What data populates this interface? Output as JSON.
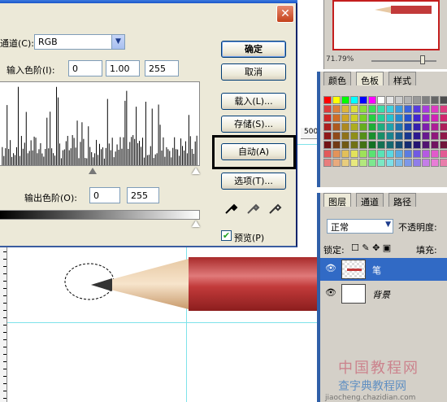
{
  "dialog": {
    "close_glyph": "✕",
    "channel_label": "通道(C):",
    "channel_value": "RGB",
    "input_levels_label": "输入色阶(I):",
    "input_levels": [
      "0",
      "1.00",
      "255"
    ],
    "output_levels_label": "输出色阶(O):",
    "output_levels": [
      "0",
      "255"
    ],
    "buttons": {
      "ok": "确定",
      "cancel": "取消",
      "load": "载入(L)...",
      "save": "存储(S)...",
      "auto": "自动(A)",
      "options": "选项(T)..."
    },
    "preview_label": "预览(P)",
    "preview_checked": true
  },
  "navigator": {
    "zoom": "71.79%"
  },
  "swatches": {
    "tabs": [
      "颜色",
      "色板",
      "样式"
    ],
    "active_tab": "色板"
  },
  "ruler": {
    "h_label": "500"
  },
  "layers": {
    "tabs": [
      "图层",
      "通道",
      "路径"
    ],
    "blend_mode": "正常",
    "opacity_label": "不透明度:",
    "lock_label": "锁定:",
    "fill_label": "填充:",
    "items": [
      {
        "name": "笔",
        "selected": true
      },
      {
        "name": "背景",
        "selected": false
      }
    ]
  },
  "watermark": {
    "line1": "中国教程网",
    "line2": "查字典教程网",
    "line3": "jiaocheng.chazidian.com"
  },
  "colors": {
    "selection_blue": "#316ac5",
    "pencil_red": "#c23a3a",
    "guide_cyan": "#7fe3ea"
  }
}
